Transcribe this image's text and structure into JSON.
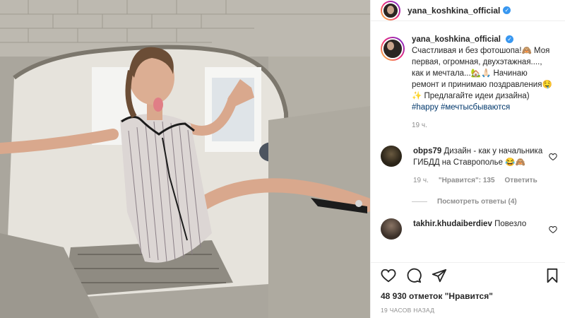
{
  "header": {
    "username": "yana_koshkina_official"
  },
  "caption": {
    "username": "yana_koshkina_official",
    "text": "Счастливая и без фотошопа!🙈 Моя первая, огромная, двухэтажная...., как и мечтала...🏡🙏🏻 Начинаю ремонт и принимаю поздравления🤤✨ Предлагайте идеи дизайна)",
    "tags": [
      "#happy",
      "#мечтысбываются"
    ],
    "time": "19 ч."
  },
  "comments": [
    {
      "username": "obps79",
      "text": "Дизайн - как у начальника ГИБДД на Ставрополье 😂🙈",
      "time": "19 ч.",
      "likes_label": "\"Нравится\": 135",
      "reply_label": "Ответить",
      "view_replies": "Посмотреть ответы (4)"
    },
    {
      "username": "takhir.khudaiberdiev",
      "text": "Повезло"
    }
  ],
  "footer": {
    "likes": "48 930 отметок \"Нравится\"",
    "posted": "19 ЧАСОВ НАЗАД"
  },
  "icons": [
    "heart-icon",
    "comment-icon",
    "share-icon",
    "bookmark-icon",
    "verified-icon"
  ],
  "colors": {
    "link": "#00376b",
    "verified": "#3897f0",
    "muted": "#8e8e8e"
  }
}
